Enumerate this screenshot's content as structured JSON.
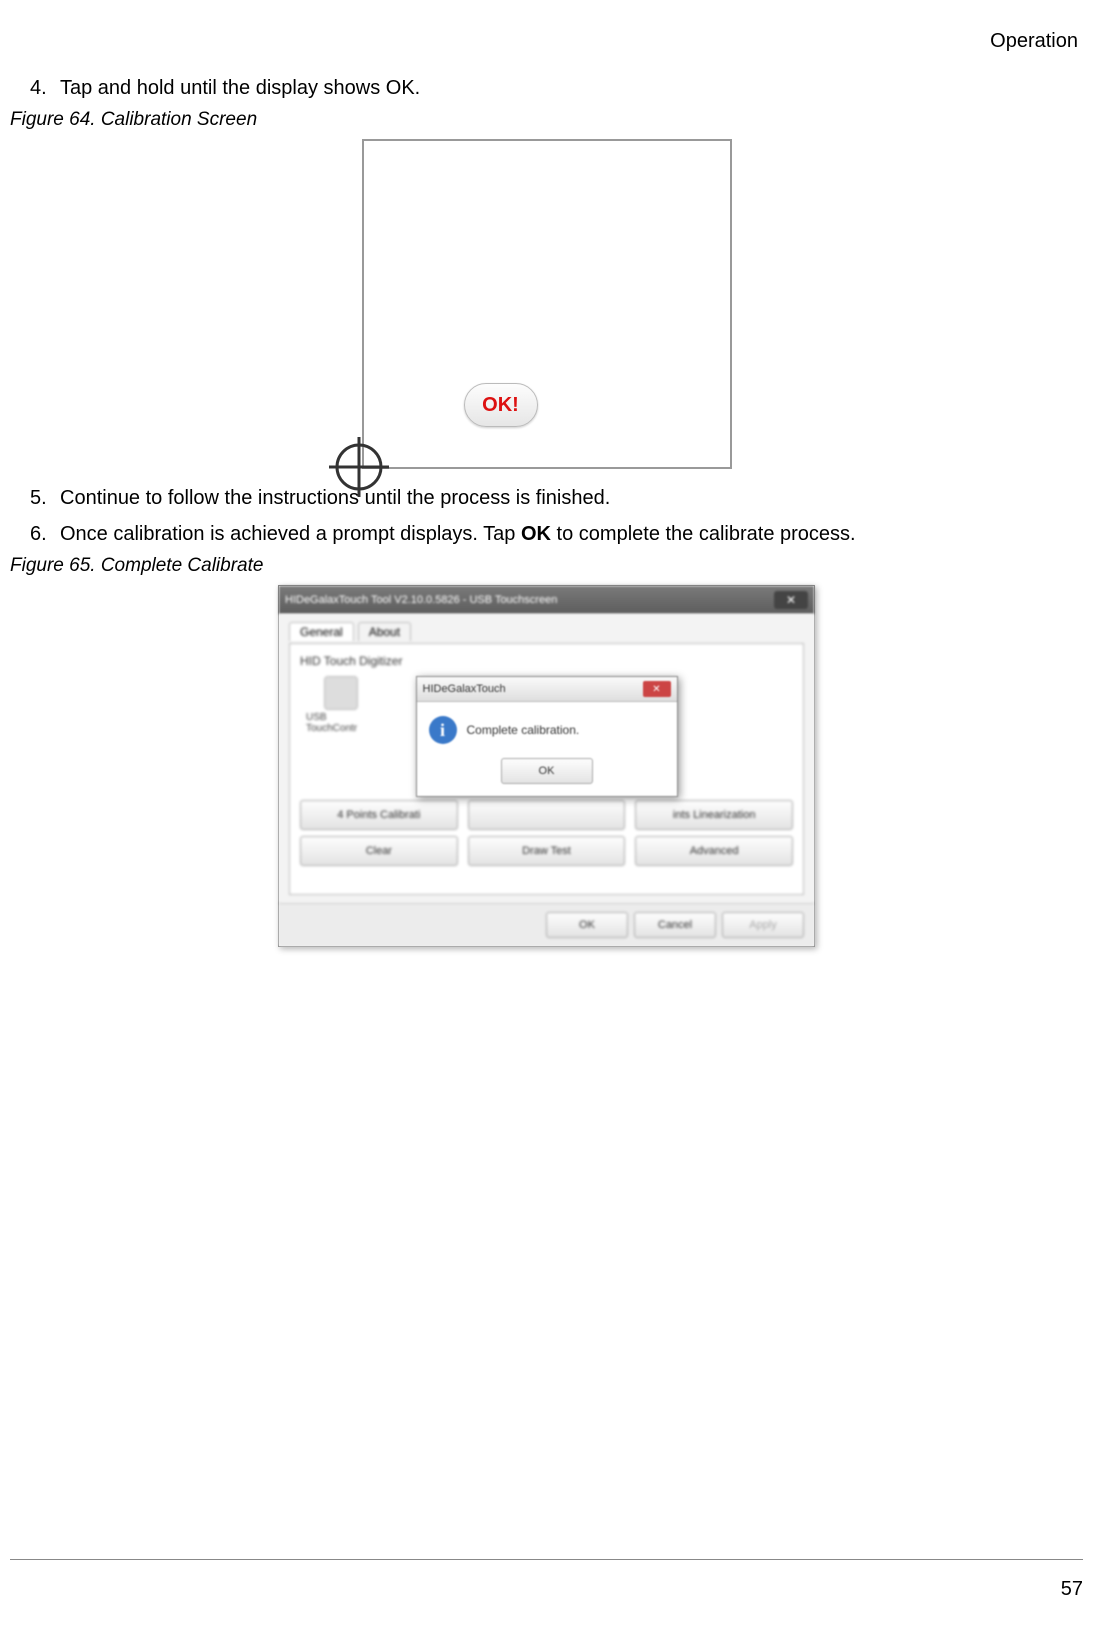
{
  "section": "Operation",
  "page_number": "57",
  "steps": [
    {
      "num": "4.",
      "text": "Tap and hold until the display shows OK."
    },
    {
      "num": "5.",
      "text": "Continue to follow the instructions until the process is finished."
    },
    {
      "num": "6.",
      "prefix": "Once calibration is achieved a prompt displays. Tap ",
      "bold": "OK",
      "suffix": " to complete the calibrate process."
    }
  ],
  "figure64": {
    "caption": "Figure 64.  Calibration Screen",
    "ok_label": "OK!"
  },
  "figure65": {
    "caption": "Figure 65.  Complete Calibrate",
    "window_title": "HIDeGalaxTouch Tool V2.10.0.5826 - USB Touchscreen",
    "tabs": {
      "general": "General",
      "about": "About"
    },
    "panel_header": "HID Touch Digitizer",
    "side_label": "USB TouchContr",
    "buttons_row1": {
      "b1": "4 Points Calibrati",
      "b2": "",
      "b3": "ints Linearization"
    },
    "buttons_row2": {
      "b1": "Clear",
      "b2": "Draw Test",
      "b3": "Advanced"
    },
    "bottom": {
      "ok": "OK",
      "cancel": "Cancel",
      "apply": "Apply"
    },
    "dialog": {
      "title": "HIDeGalaxTouch",
      "message": "Complete calibration.",
      "ok": "OK"
    }
  }
}
